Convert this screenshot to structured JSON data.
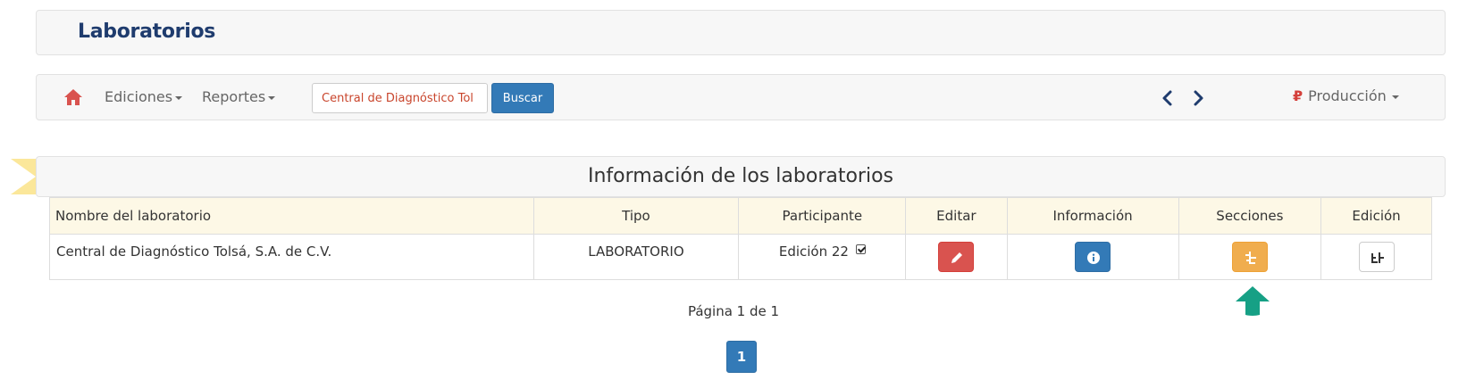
{
  "header": {
    "title": "Laboratorios"
  },
  "nav": {
    "ediciones_label": "Ediciones",
    "reportes_label": "Reportes",
    "search_value": "Central de Diagnóstico Tol",
    "search_button": "Buscar",
    "produccion_label": "Producción",
    "produccion_icon": "ruble-icon",
    "ruble_symbol": "₽",
    "home_icon": "home-icon",
    "prev_icon": "chevron-left-icon",
    "next_icon": "chevron-right-icon"
  },
  "section": {
    "title": "Información de los laboratorios"
  },
  "table": {
    "columns": [
      "Nombre del laboratorio",
      "Tipo",
      "Participante",
      "Editar",
      "Información",
      "Secciones",
      "Edición"
    ],
    "rows": [
      {
        "nombre": "Central de Diagnóstico Tolsá, S.A. de C.V.",
        "tipo": "LABORATORIO",
        "participante": "Edición 22",
        "participante_checked": true
      }
    ]
  },
  "pagination": {
    "text": "Página 1 de 1",
    "current": "1"
  },
  "colors": {
    "primary": "#337ab7",
    "danger": "#d9534f",
    "warning": "#f0ad4e",
    "teal_arrow": "#16a085",
    "title_blue": "#1f3c6e",
    "home_red": "#d9534f"
  }
}
